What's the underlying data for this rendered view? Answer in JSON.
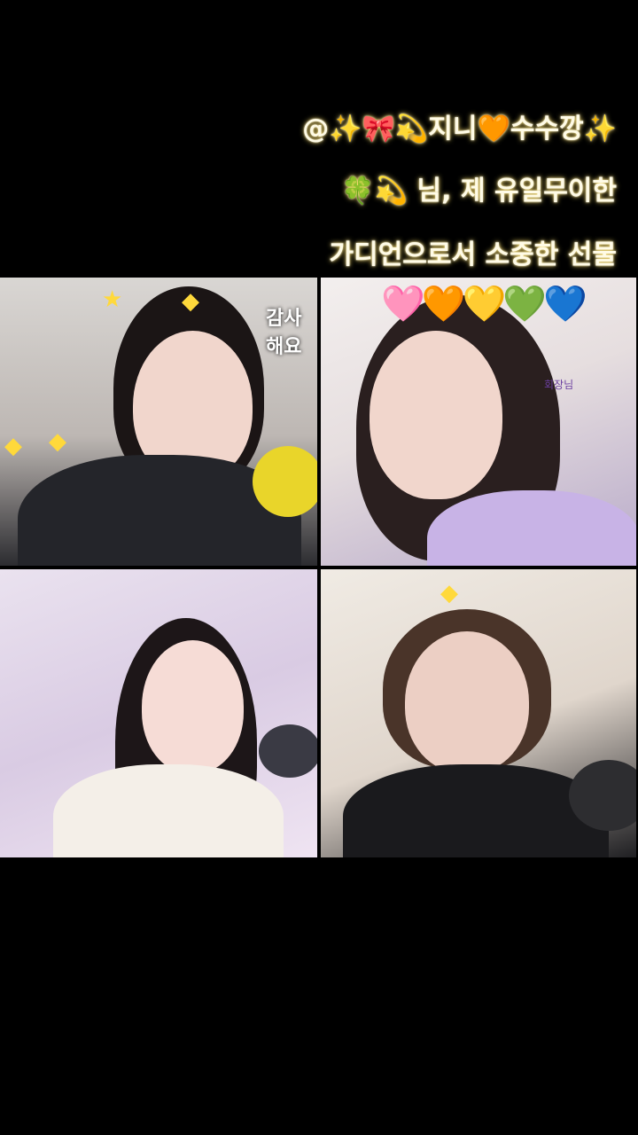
{
  "captions": {
    "line1": "@✨🎀💫지니🧡수수깡✨",
    "line2": "🍀💫 님, 제 유일무이한",
    "line3": "가디언으로서 소중한 선물"
  },
  "tiles": {
    "top_left": {
      "effect_text": "감사해요"
    },
    "top_right": {
      "hearts": "🩷🧡💛💚💙",
      "label": "회장님"
    },
    "bottom_left": {},
    "bottom_right": {}
  },
  "colors": {
    "background": "#000000",
    "caption_glow": "#ffe066"
  }
}
